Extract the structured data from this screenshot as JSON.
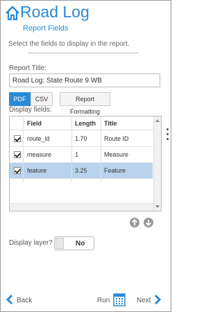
{
  "header": {
    "title": "Road Log",
    "subtitle": "Report Fields"
  },
  "instructions": "Select the fields to display in the report.",
  "report_title": {
    "label": "Report Title:",
    "value": "Road Log: State Route 9 WB"
  },
  "format_buttons": {
    "pdf": "PDF",
    "csv": "CSV",
    "formatting": "Report Formatting"
  },
  "display_fields": {
    "label": "Display fields:",
    "columns": [
      "Field",
      "Length",
      "Title"
    ],
    "rows": [
      {
        "field": "route_id",
        "length": "1.70",
        "title": "Route ID"
      },
      {
        "field": "measure",
        "length": "1",
        "title": "Measure"
      },
      {
        "field": "feature",
        "length": "3.25",
        "title": "Feature"
      }
    ]
  },
  "display_layer": {
    "label": "Display layer?",
    "value": "No"
  },
  "footer": {
    "back": "Back",
    "run": "Run",
    "next": "Next"
  },
  "colors": {
    "accent": "#2a8ad6",
    "selected_row": "#b9d3ee"
  },
  "icons": [
    "home-icon",
    "up-arrow-icon",
    "down-arrow-icon",
    "back-arrow-icon",
    "run-report-icon",
    "next-arrow-icon",
    "more-options-icon"
  ]
}
